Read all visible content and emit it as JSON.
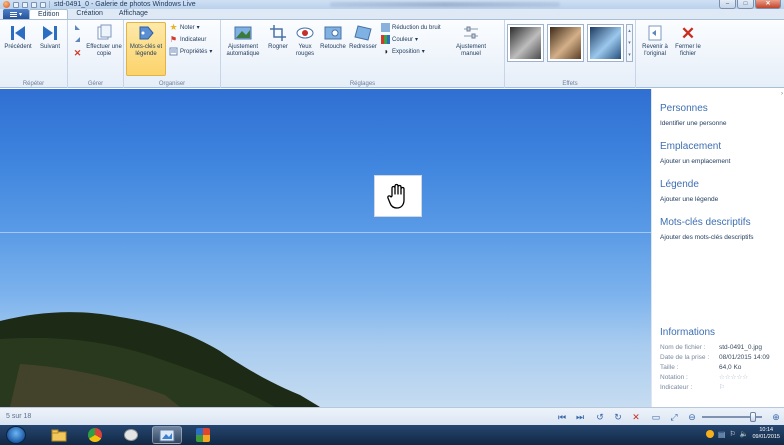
{
  "window": {
    "title": "std-0491_0 - Galerie de photos Windows Live"
  },
  "tabs": [
    {
      "label": "Edition",
      "active": true
    },
    {
      "label": "Création",
      "active": false
    },
    {
      "label": "Affichage",
      "active": false
    }
  ],
  "ribbon": {
    "groups": {
      "repeter": "Répéter",
      "gerer": "Gérer",
      "organiser": "Organiser",
      "reglages": "Réglages",
      "effets": "Effets"
    },
    "buttons": {
      "precedent": "Précédent",
      "suivant": "Suivant",
      "effectuer_copie": "Effectuer une copie",
      "motscles_line1": "Mots-clés et",
      "motscles_line2": "légende",
      "noter": "Noter",
      "indicateur": "Indicateur",
      "proprietes": "Propriétés",
      "ajustement_auto": "Ajustement automatique",
      "rogner": "Rogner",
      "yeux_rouges": "Yeux rouges",
      "retouche": "Retouche",
      "redresser": "Redresser",
      "reduction_bruit": "Réduction du bruit",
      "couleur": "Couleur",
      "exposition": "Exposition",
      "ajustement_manuel": "Ajustement manuel",
      "revenir_original": "Revenir à l'original",
      "fermer_fichier": "Fermer le fichier"
    }
  },
  "panel": {
    "personnes": {
      "title": "Personnes",
      "link": "Identifier une personne"
    },
    "emplacement": {
      "title": "Emplacement",
      "link": "Ajouter un emplacement"
    },
    "legende": {
      "title": "Légende",
      "link": "Ajouter une légende"
    },
    "motscles": {
      "title": "Mots-clés descriptifs",
      "link": "Ajouter des mots-clés descriptifs"
    },
    "informations": {
      "title": "Informations",
      "rows": [
        {
          "key": "Nom de fichier :",
          "value": "std-0491_0.jpg"
        },
        {
          "key": "Date de la prise :",
          "value": "08/01/2015 14:09"
        },
        {
          "key": "Taille :",
          "value": "64,0 Ko"
        },
        {
          "key": "Notation :",
          "value": "☆☆☆☆☆"
        },
        {
          "key": "Indicateur :",
          "value": "⚐"
        }
      ]
    }
  },
  "status": {
    "position": "5 sur 18"
  },
  "taskbar": {
    "time": "10:14",
    "date": "09/01/2015"
  },
  "colors": {
    "accent": "#3d6fb3",
    "ribbon_bg": "#e6eef8",
    "selected_button": "#fbd36a"
  }
}
